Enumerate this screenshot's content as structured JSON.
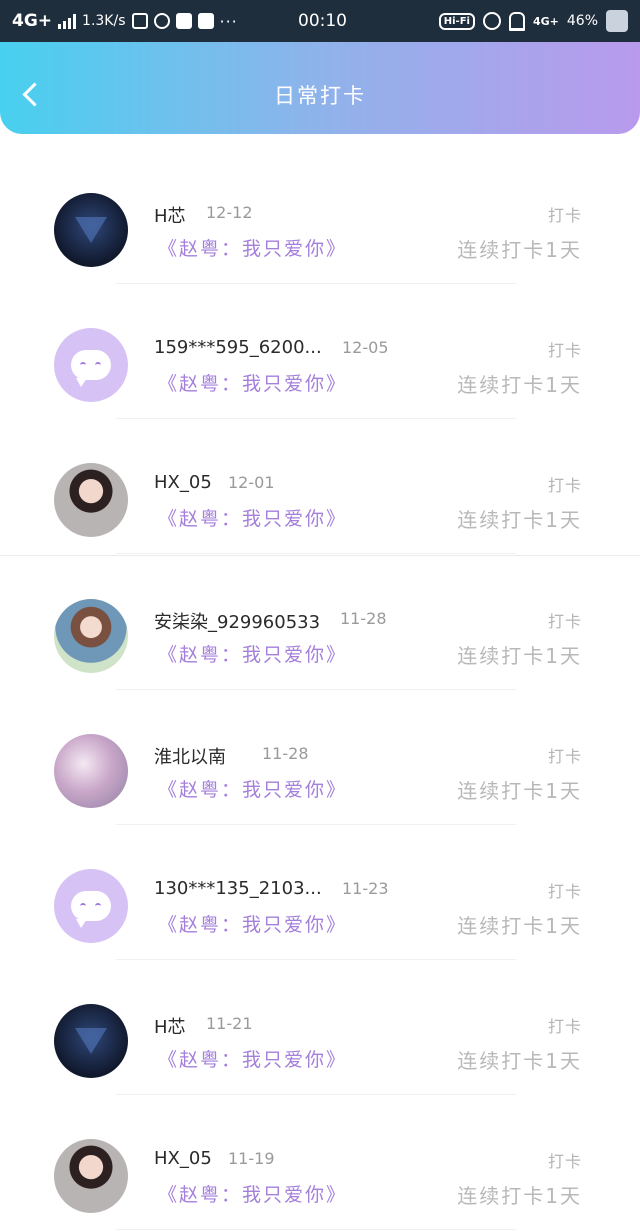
{
  "status_bar": {
    "network": "4G+",
    "speed": "1.3K/s",
    "dots": "···",
    "time": "00:10",
    "hifi": "Hi-Fi",
    "network_right": "4G+",
    "battery": "46%"
  },
  "header": {
    "title": "日常打卡",
    "back_icon": "chevron-left-icon",
    "gradient": [
      "#48d0ef",
      "#b99aec"
    ]
  },
  "checkin_label": "打卡",
  "items": [
    {
      "name": "H芯",
      "date": "12-12",
      "verse": "《赵粤：我只爱你》",
      "streak": "连续打卡1天",
      "avatar": "dark"
    },
    {
      "name": "159***595_6200...",
      "date": "12-05",
      "verse": "《赵粤：我只爱你》",
      "streak": "连续打卡1天",
      "avatar": "chat"
    },
    {
      "name": "HX_05",
      "date": "12-01",
      "verse": "《赵粤：我只爱你》",
      "streak": "连续打卡1天",
      "avatar": "photo-a"
    },
    {
      "name": "安柒染_929960533",
      "date": "11-28",
      "verse": "《赵粤：我只爱你》",
      "streak": "连续打卡1天",
      "avatar": "photo-b"
    },
    {
      "name": "淮北以南",
      "date": "11-28",
      "verse": "《赵粤：我只爱你》",
      "streak": "连续打卡1天",
      "avatar": "photo-c"
    },
    {
      "name": "130***135_2103...",
      "date": "11-23",
      "verse": "《赵粤：我只爱你》",
      "streak": "连续打卡1天",
      "avatar": "chat"
    },
    {
      "name": "H芯",
      "date": "11-21",
      "verse": "《赵粤：我只爱你》",
      "streak": "连续打卡1天",
      "avatar": "dark"
    },
    {
      "name": "HX_05",
      "date": "11-19",
      "verse": "《赵粤：我只爱你》",
      "streak": "连续打卡1天",
      "avatar": "photo-a"
    }
  ],
  "colors": {
    "verse": "#a47fdb",
    "status_bar": "#1f2e3c"
  }
}
